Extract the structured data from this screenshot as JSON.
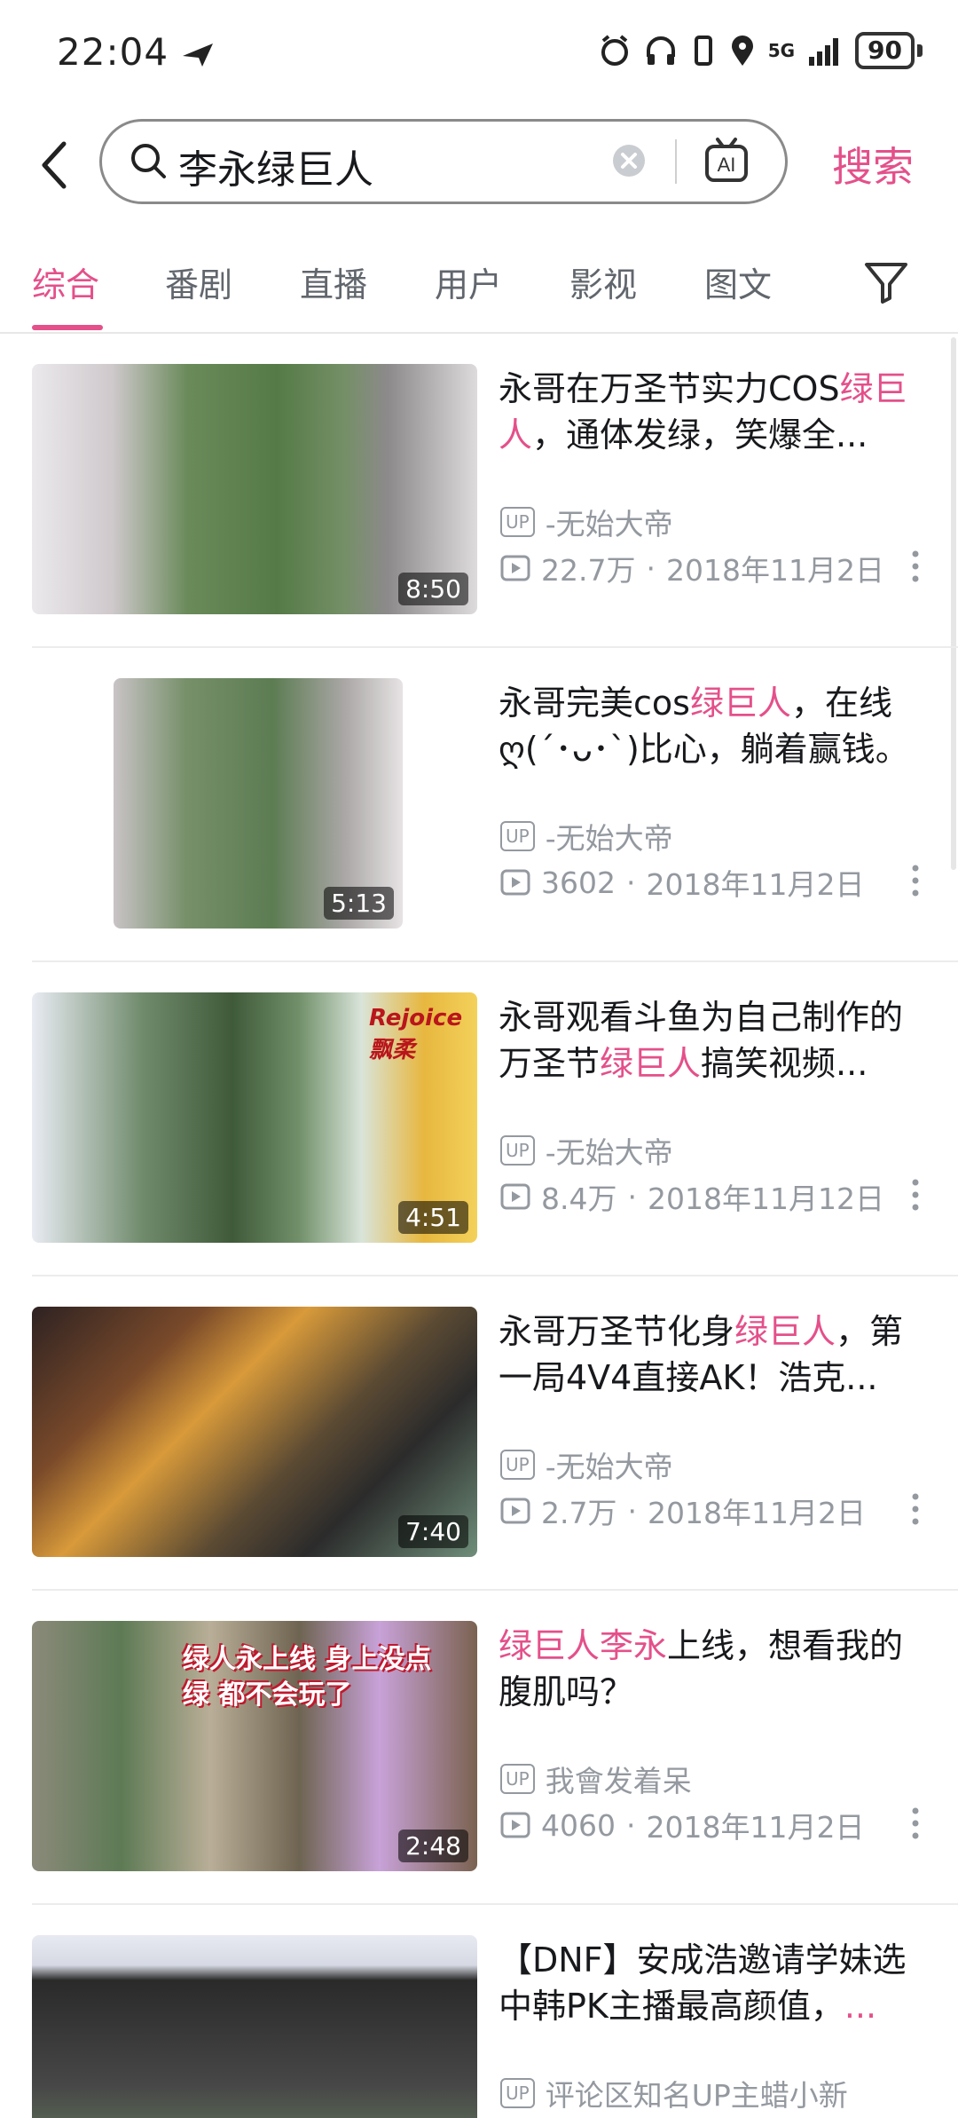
{
  "status_bar": {
    "time": "22:04",
    "network": "5G",
    "battery": "90"
  },
  "search": {
    "query": "李永绿巨人",
    "action_label": "搜索",
    "ai_label": "AI"
  },
  "tabs": [
    {
      "label": "综合",
      "active": true
    },
    {
      "label": "番剧"
    },
    {
      "label": "直播"
    },
    {
      "label": "用户"
    },
    {
      "label": "影视"
    },
    {
      "label": "图文"
    }
  ],
  "colors": {
    "accent": "#e4508a",
    "meta_gray": "#9499a0"
  },
  "results": [
    {
      "title_before": "永哥在万圣节实力COS",
      "title_highlight": "绿巨人",
      "title_after": "，通体发绿，笑爆全...",
      "up_tag": "UP",
      "uploader": "-无始大帝",
      "views": "22.7万",
      "date": "2018年11月2日",
      "duration": "8:50"
    },
    {
      "title_before": "永哥完美cos",
      "title_highlight": "绿巨人",
      "title_after": "，在线ღ(´･ᴗ･`)比心，躺着赢钱。",
      "up_tag": "UP",
      "uploader": "-无始大帝",
      "views": "3602",
      "date": "2018年11月2日",
      "duration": "5:13"
    },
    {
      "title_before": "永哥观看斗鱼为自己制作的万圣节",
      "title_highlight": "绿巨人",
      "title_after": "搞笑视频...",
      "up_tag": "UP",
      "uploader": "-无始大帝",
      "views": "8.4万",
      "date": "2018年11月12日",
      "duration": "4:51",
      "thumb_text": "Rejoice 飘柔"
    },
    {
      "title_before": "永哥万圣节化身",
      "title_highlight": "绿巨人",
      "title_after": "，第一局4V4直接AK！浩克...",
      "up_tag": "UP",
      "uploader": "-无始大帝",
      "views": "2.7万",
      "date": "2018年11月2日",
      "duration": "7:40"
    },
    {
      "title_before": "",
      "title_highlight": "绿巨人李永",
      "title_after": "上线，想看我的腹肌吗？",
      "up_tag": "UP",
      "uploader": "我會发着呆",
      "views": "4060",
      "date": "2018年11月2日",
      "duration": "2:48",
      "thumb_text": "绿人永上线 身上没点绿 都不会玩了"
    },
    {
      "title_before": "【DNF】安成浩邀请学妹选中韩PK主播最高颜值，",
      "title_highlight": "...",
      "title_after": "",
      "up_tag": "UP",
      "uploader": "评论区知名UP主蜡小新"
    }
  ]
}
